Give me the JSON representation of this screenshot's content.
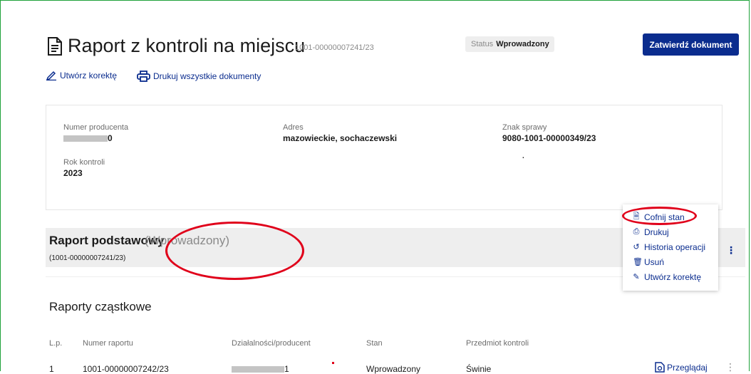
{
  "header": {
    "title": "Raport z kontroli na miejscu",
    "doc_number": "1001-00000007241/23",
    "status_label": "Status",
    "status_value": "Wprowadzony",
    "confirm_button": "Zatwierdź dokument"
  },
  "actions": {
    "create_correction": "Utwórz korektę",
    "print_all": "Drukuj wszystkie dokumenty"
  },
  "info": {
    "producer_label": "Numer producenta",
    "producer_value_suffix": "0",
    "address_label": "Adres",
    "address_value": "mazowieckie, sochaczewski",
    "case_label": "Znak sprawy",
    "case_value": "9080-1001-00000349/23",
    "case_extra": ".",
    "year_label": "Rok kontroli",
    "year_value": "2023"
  },
  "basic_report": {
    "title": "Raport podstawowy",
    "state": "(Wprowadzony)",
    "number": "(1001-00000007241/23)",
    "more_icon": "kebab-icon"
  },
  "menu": {
    "items": [
      {
        "label": "Cofnij stan",
        "icon": "undo-doc-icon"
      },
      {
        "label": "Drukuj",
        "icon": "printer-icon"
      },
      {
        "label": "Historia operacji",
        "icon": "history-icon"
      },
      {
        "label": "Usuń",
        "icon": "trash-icon"
      },
      {
        "label": "Utwórz korektę",
        "icon": "pencil-icon"
      }
    ]
  },
  "partial_reports": {
    "title": "Raporty cząstkowe",
    "columns": [
      "L.p.",
      "Numer raportu",
      "Działalności/producent",
      "Stan",
      "Przedmiot kontroli"
    ],
    "rows": [
      {
        "lp": "1",
        "number": "1001-00000007242/23",
        "producer_suffix": "1",
        "state": "Wprowadzony",
        "subject": "Świnie",
        "action": "Przeglądaj"
      }
    ]
  },
  "colors": {
    "accent": "#0a2c8e",
    "annotation": "#e0001a",
    "frame": "#1fa23a"
  }
}
